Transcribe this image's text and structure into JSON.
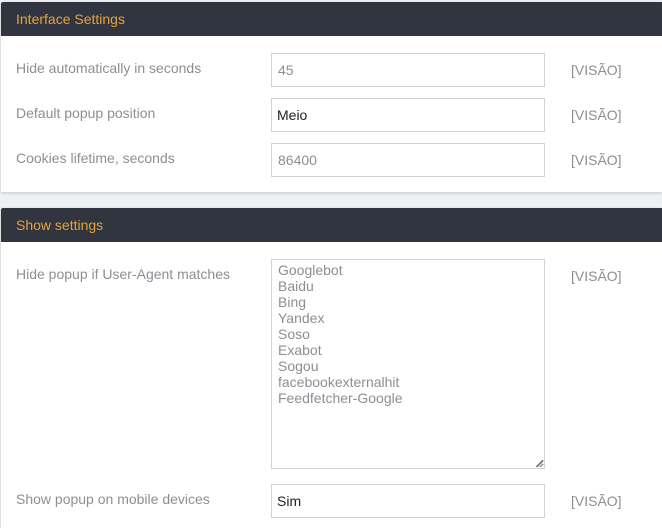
{
  "interface_settings": {
    "title": "Interface Settings",
    "rows": [
      {
        "label": "Hide automatically in seconds",
        "value": "45",
        "scope": "[VISÃO]"
      },
      {
        "label": "Default popup position",
        "value": "Meio",
        "scope": "[VISÃO]"
      },
      {
        "label": "Cookies lifetime, seconds",
        "value": "86400",
        "scope": "[VISÃO]"
      }
    ]
  },
  "show_settings": {
    "title": "Show settings",
    "user_agent": {
      "label": "Hide popup if User-Agent matches",
      "value": "Googlebot\nBaidu\nBing\nYandex\nSoso\nExabot\nSogou\nfacebookexternalhit\nFeedfetcher-Google",
      "scope": "[VISÃO]"
    },
    "mobile": {
      "label": "Show popup on mobile devices",
      "value": "Sim",
      "scope": "[VISÃO]"
    }
  },
  "colors": {
    "header_bg": "#303540",
    "header_text": "#e8a13a",
    "label_text": "#8b8f94"
  }
}
